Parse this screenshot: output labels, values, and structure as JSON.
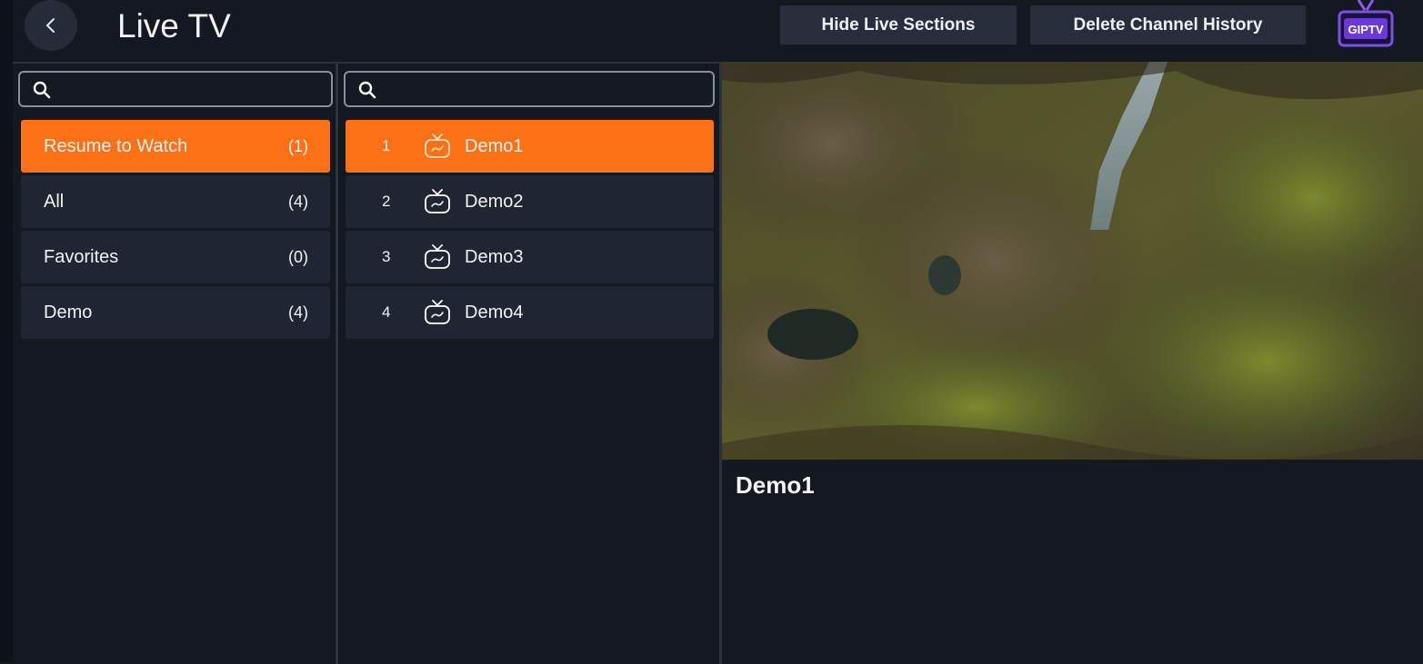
{
  "header": {
    "title": "Live TV",
    "hide_live_sections": "Hide Live Sections",
    "delete_channel_history": "Delete Channel History",
    "logo_text": "GIPTV"
  },
  "categories": {
    "search_placeholder": "",
    "items": [
      {
        "label": "Resume to Watch",
        "count": "(1)",
        "active": true
      },
      {
        "label": "All",
        "count": "(4)",
        "active": false
      },
      {
        "label": "Favorites",
        "count": "(0)",
        "active": false
      },
      {
        "label": "Demo",
        "count": "(4)",
        "active": false
      }
    ]
  },
  "channels": {
    "search_placeholder": "",
    "items": [
      {
        "number": "1",
        "name": "Demo1",
        "active": true
      },
      {
        "number": "2",
        "name": "Demo2",
        "active": false
      },
      {
        "number": "3",
        "name": "Demo3",
        "active": false
      },
      {
        "number": "4",
        "name": "Demo4",
        "active": false
      }
    ]
  },
  "player": {
    "now_playing": "Demo1"
  },
  "colors": {
    "accent": "#fd7116",
    "background": "#141820",
    "item": "#1f2531"
  }
}
